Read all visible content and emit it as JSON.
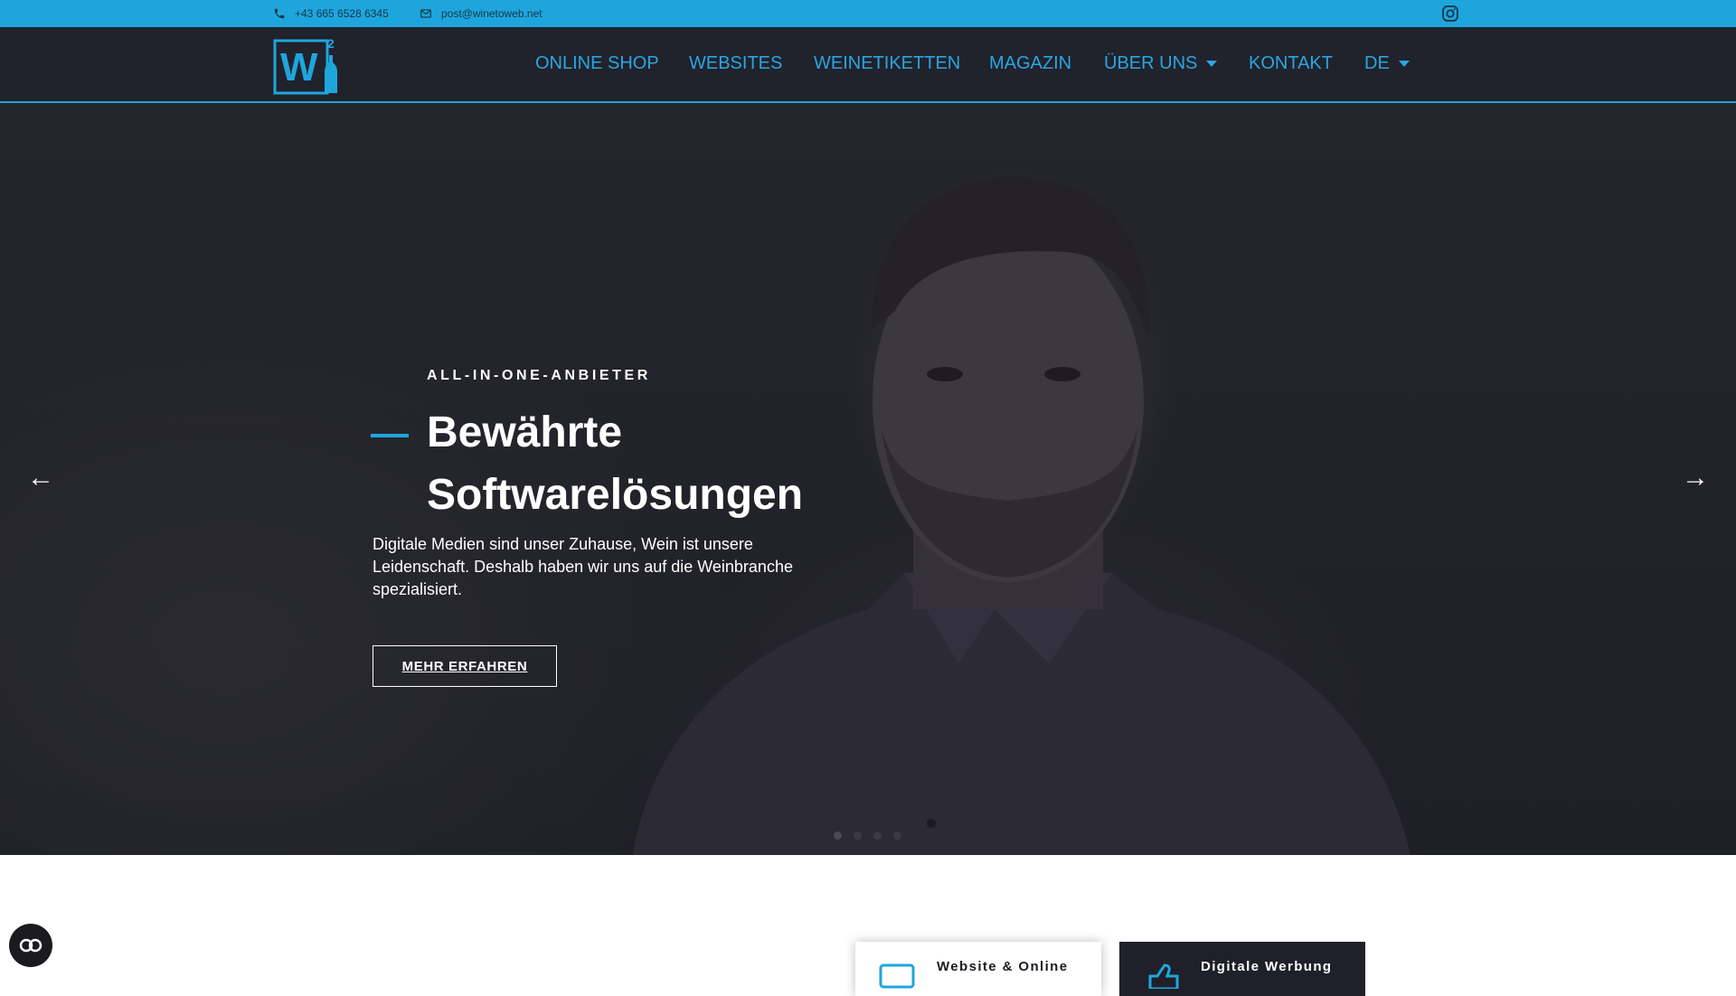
{
  "topbar": {
    "phone": "+43 665 6528 6345",
    "email": "post@winetoweb.net",
    "social_icon": "instagram-icon"
  },
  "header": {
    "logo_letter": "W",
    "logo_superscript": "2",
    "nav": [
      {
        "label": "ONLINE SHOP",
        "has_dropdown": false
      },
      {
        "label": "WEBSITES",
        "has_dropdown": false
      },
      {
        "label": "WEINETIKETTEN",
        "has_dropdown": false
      },
      {
        "label": "MAGAZIN",
        "has_dropdown": false
      },
      {
        "label": "ÜBER UNS",
        "has_dropdown": true
      },
      {
        "label": "KONTAKT",
        "has_dropdown": false
      },
      {
        "label": "DE",
        "has_dropdown": true
      }
    ]
  },
  "hero": {
    "eyebrow": "ALL-IN-ONE-ANBIETER",
    "headline": "Bewährte Softwarelösungen",
    "lead": "Digitale Medien sind unser Zuhause, Wein ist unsere Leidenschaft. Deshalb haben wir uns auf die Weinbranche spezialisiert.",
    "cta": "MEHR ERFAHREN",
    "prev_arrow": "←",
    "next_arrow": "→",
    "slide_count": 4,
    "active_slide": 1
  },
  "services": {
    "card_web": "Website & Online",
    "card_ads": "Digitale Werbung"
  },
  "colors": {
    "accent": "#1ea6dc",
    "header_bg": "#20222c",
    "hero_bg": "#22222a"
  }
}
